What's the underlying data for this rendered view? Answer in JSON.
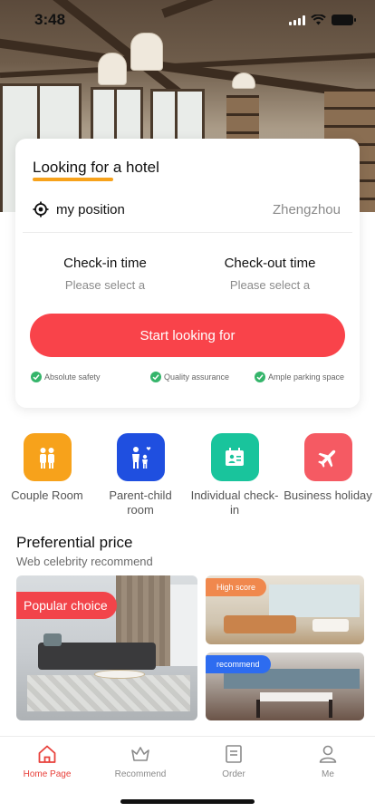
{
  "status_bar": {
    "time": "3:48"
  },
  "search_card": {
    "title": "Looking for a hotel",
    "position_label": "my position",
    "city": "Zhengzhou",
    "checkin_label": "Check-in time",
    "checkin_placeholder": "Please select a",
    "checkout_label": "Check-out time",
    "checkout_placeholder": "Please select a",
    "start_button": "Start looking for",
    "badges": [
      "Absolute safety",
      "Quality assurance",
      "Ample parking space"
    ]
  },
  "categories": [
    {
      "label": "Couple Room",
      "icon": "couple-icon",
      "color": "#f7a21b"
    },
    {
      "label": "Parent-child room",
      "icon": "parent-child-icon",
      "color": "#1f4fe0"
    },
    {
      "label": "Individual check-in",
      "icon": "id-card-icon",
      "color": "#19c49c"
    },
    {
      "label": "Business holiday",
      "icon": "airplane-icon",
      "color": "#f55a63"
    }
  ],
  "preferential": {
    "title": "Preferential price",
    "subtitle": "Web celebrity recommend",
    "tiles": [
      {
        "tag": "Popular choice",
        "tag_color": "#f2444a"
      },
      {
        "tag": "High score",
        "tag_color": "#f0884d"
      },
      {
        "tag": "recommend",
        "tag_color": "#2d6cf0"
      }
    ]
  },
  "tabs": [
    {
      "label": "Home Page",
      "icon": "home-icon",
      "active": true
    },
    {
      "label": "Recommend",
      "icon": "crown-icon",
      "active": false
    },
    {
      "label": "Order",
      "icon": "order-icon",
      "active": false
    },
    {
      "label": "Me",
      "icon": "user-icon",
      "active": false
    }
  ],
  "colors": {
    "accent": "#f9434a",
    "underline": "#f7a21b",
    "check": "#35b56b",
    "active_tab": "#e8413b"
  }
}
